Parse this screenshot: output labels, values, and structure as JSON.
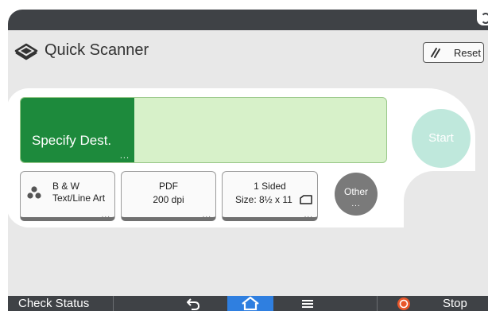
{
  "app": {
    "title": "Quick Scanner"
  },
  "header": {
    "reset_label": "Reset"
  },
  "destination": {
    "button_label": "Specify Dest.",
    "more": "..."
  },
  "start": {
    "label": "Start"
  },
  "settings": [
    {
      "line1": "B & W",
      "line2": "Text/Line Art",
      "more": "..."
    },
    {
      "line1": "PDF",
      "line2": "200 dpi",
      "more": "..."
    },
    {
      "line1": "1 Sided",
      "line2": "Size: 8½ x 11",
      "more": "..."
    }
  ],
  "other": {
    "label": "Other",
    "more": "..."
  },
  "bottom_bar": {
    "check_status": "Check Status",
    "stop": "Stop"
  },
  "colors": {
    "destination_button": "#1d8a3c",
    "destination_field": "#d7f1c9",
    "start_button": "#bfe8dc",
    "home_button": "#2f7fe0",
    "bar": "#3f4246",
    "stop_icon": "#e8562a"
  },
  "icons": {
    "app": "scanner-icon",
    "reset": "reset-icon",
    "color_mode": "color-dots-icon",
    "orientation": "original-orientation-icon",
    "back": "back-arrow-icon",
    "home": "home-icon",
    "menu": "menu-icon",
    "stop": "stop-icon"
  }
}
